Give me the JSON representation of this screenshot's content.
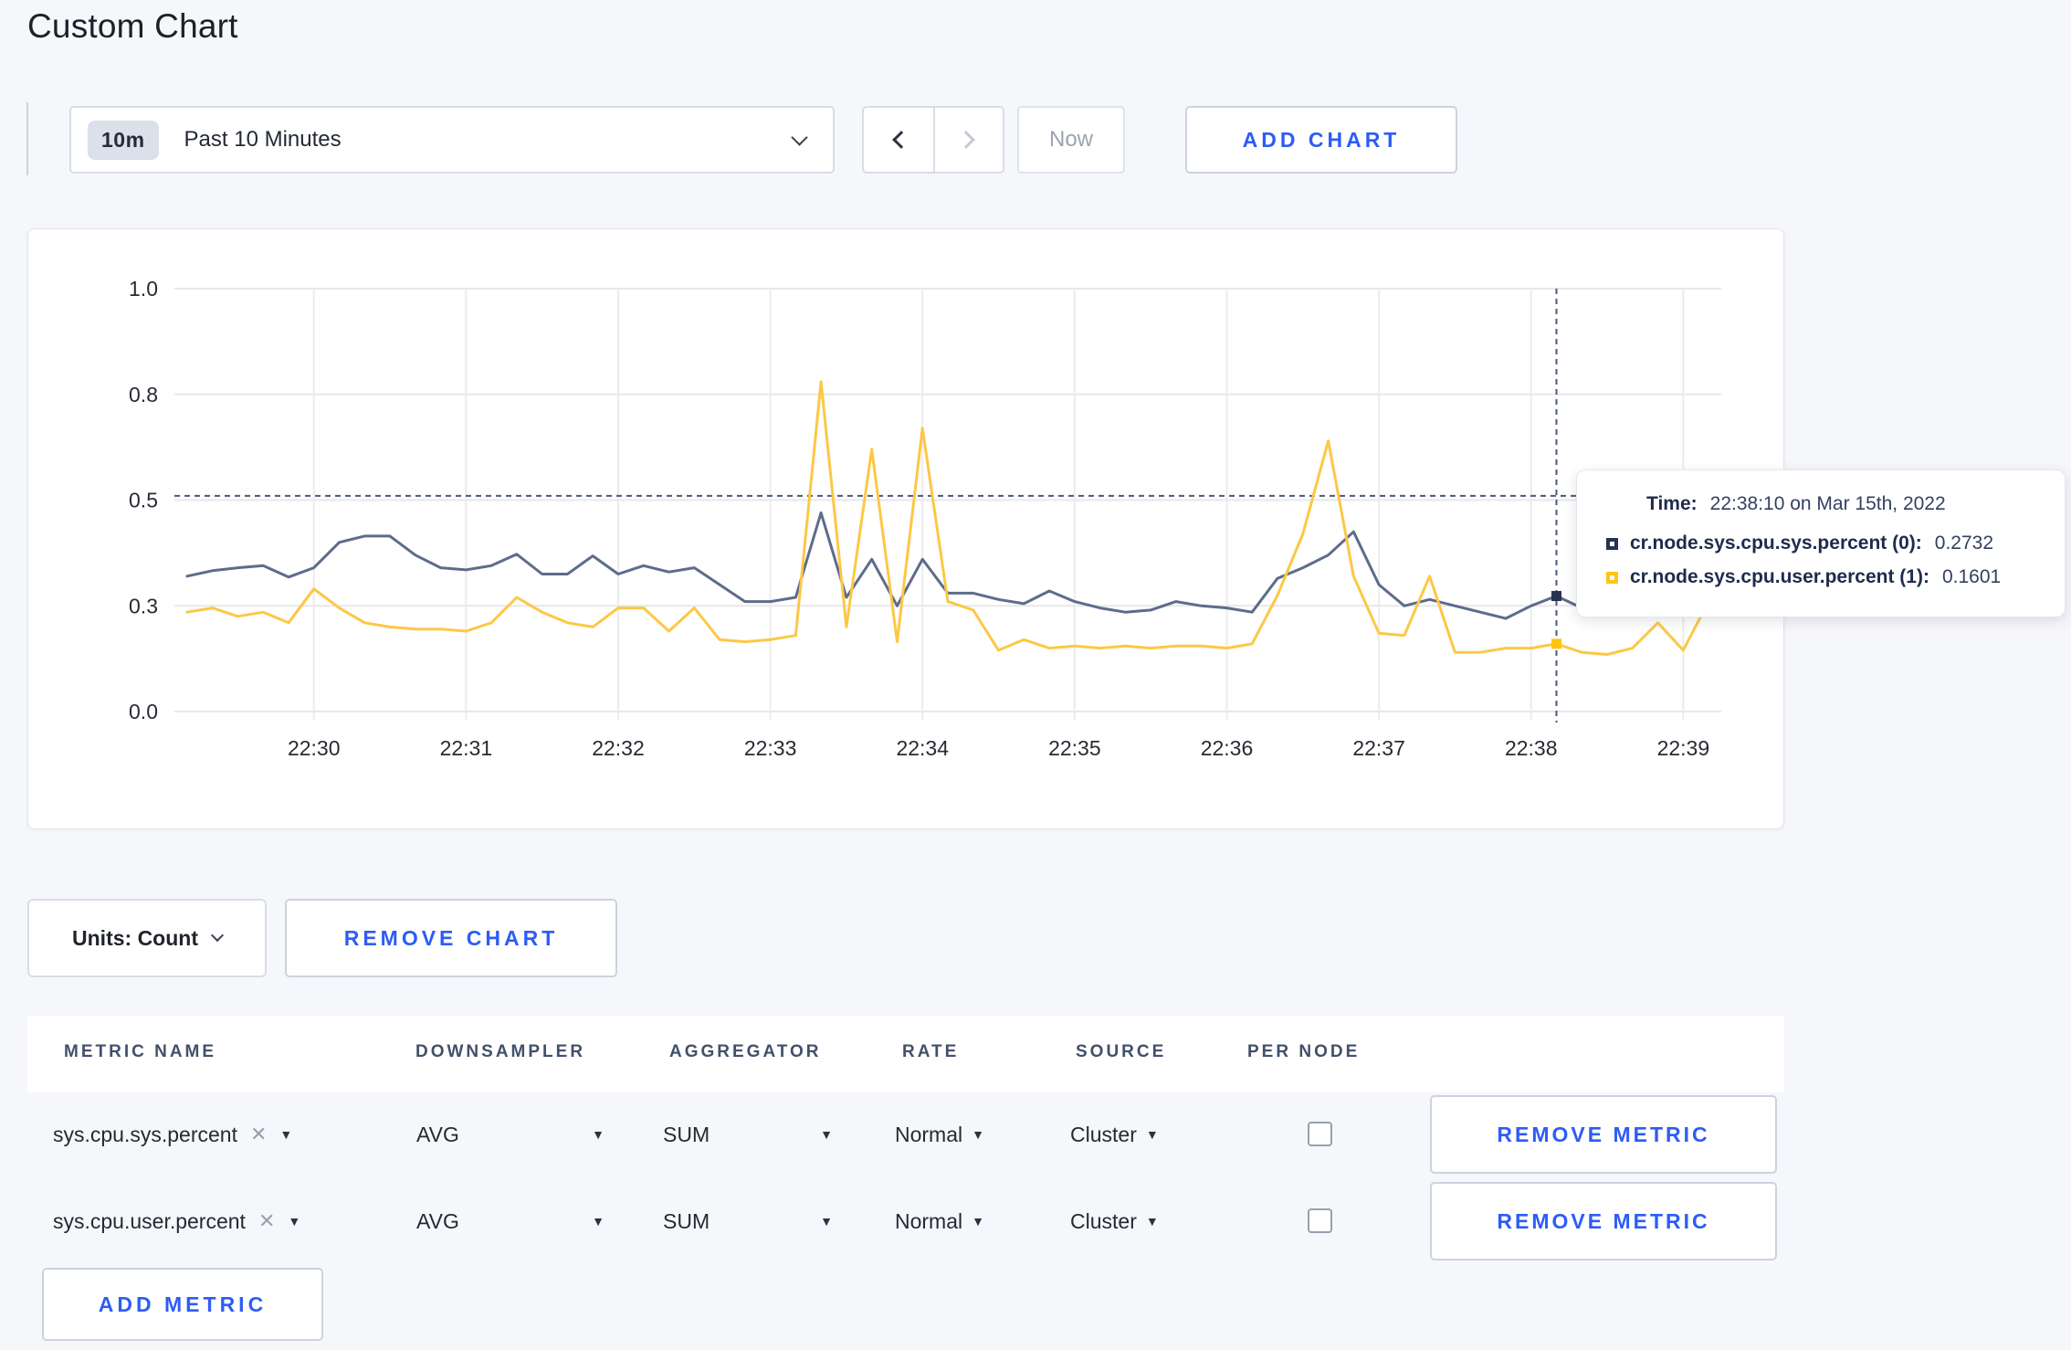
{
  "page": {
    "title": "Custom Chart",
    "accent_blue": "#2d5cf6",
    "background": "#f6f7fa"
  },
  "toolbar": {
    "time_badge": "10m",
    "time_label": "Past 10 Minutes",
    "now_label": "Now",
    "add_chart_label": "ADD CHART"
  },
  "chart_data": {
    "type": "line",
    "title": "",
    "xlabel": "",
    "ylabel": "",
    "ylim": [
      0,
      1
    ],
    "grid": true,
    "legend_position": "tooltip",
    "x_base_time": "22:29:10",
    "x_domain_seconds": [
      -5,
      605
    ],
    "y_ticks": [
      {
        "v": 0.0,
        "label": "0.0"
      },
      {
        "v": 0.25,
        "label": "0.3"
      },
      {
        "v": 0.5,
        "label": "0.5"
      },
      {
        "v": 0.75,
        "label": "0.8"
      },
      {
        "v": 1.0,
        "label": "1.0"
      }
    ],
    "x_ticks": [
      {
        "t": 50,
        "label": "22:30"
      },
      {
        "t": 110,
        "label": "22:31"
      },
      {
        "t": 170,
        "label": "22:32"
      },
      {
        "t": 230,
        "label": "22:33"
      },
      {
        "t": 290,
        "label": "22:34"
      },
      {
        "t": 350,
        "label": "22:35"
      },
      {
        "t": 410,
        "label": "22:36"
      },
      {
        "t": 470,
        "label": "22:37"
      },
      {
        "t": 530,
        "label": "22:38"
      },
      {
        "t": 590,
        "label": "22:39"
      }
    ],
    "x_seconds": [
      0,
      10,
      20,
      30,
      40,
      50,
      60,
      70,
      80,
      90,
      100,
      110,
      120,
      130,
      140,
      150,
      160,
      170,
      180,
      190,
      200,
      210,
      220,
      230,
      240,
      250,
      260,
      270,
      280,
      290,
      300,
      310,
      320,
      330,
      340,
      350,
      360,
      370,
      380,
      390,
      400,
      410,
      420,
      430,
      440,
      450,
      460,
      470,
      480,
      490,
      500,
      510,
      520,
      530,
      540,
      550,
      560,
      570,
      580,
      590,
      600
    ],
    "series": [
      {
        "name": "cr.node.sys.cpu.sys.percent",
        "line_color": "#5d6c8b",
        "legend_color": "#27334f",
        "hover_value": 0.2732,
        "values": [
          0.32,
          0.333,
          0.34,
          0.345,
          0.318,
          0.34,
          0.4,
          0.415,
          0.415,
          0.37,
          0.34,
          0.335,
          0.345,
          0.372,
          0.325,
          0.325,
          0.368,
          0.325,
          0.345,
          0.33,
          0.34,
          0.3,
          0.26,
          0.26,
          0.27,
          0.47,
          0.27,
          0.36,
          0.25,
          0.36,
          0.28,
          0.28,
          0.265,
          0.255,
          0.285,
          0.26,
          0.245,
          0.235,
          0.24,
          0.26,
          0.25,
          0.245,
          0.235,
          0.315,
          0.34,
          0.37,
          0.425,
          0.3,
          0.25,
          0.265,
          0.25,
          0.235,
          0.22,
          0.25,
          0.2732,
          0.245,
          0.285,
          0.3,
          0.285,
          0.295,
          0.3
        ]
      },
      {
        "name": "cr.node.sys.cpu.user.percent",
        "line_color": "#fcc845",
        "legend_color": "#ffc414",
        "hover_value": 0.1601,
        "values": [
          0.235,
          0.245,
          0.225,
          0.235,
          0.21,
          0.29,
          0.245,
          0.21,
          0.2,
          0.195,
          0.195,
          0.19,
          0.21,
          0.27,
          0.235,
          0.21,
          0.2,
          0.245,
          0.245,
          0.19,
          0.245,
          0.17,
          0.165,
          0.17,
          0.18,
          0.78,
          0.2,
          0.62,
          0.165,
          0.67,
          0.26,
          0.24,
          0.145,
          0.17,
          0.15,
          0.155,
          0.15,
          0.155,
          0.15,
          0.155,
          0.155,
          0.15,
          0.16,
          0.275,
          0.42,
          0.64,
          0.32,
          0.185,
          0.18,
          0.32,
          0.14,
          0.14,
          0.15,
          0.15,
          0.1601,
          0.14,
          0.135,
          0.15,
          0.21,
          0.145,
          0.26
        ]
      }
    ],
    "crosshair": {
      "t": 540,
      "v": 0.51,
      "color": "#49597a"
    },
    "colors": {
      "gridline": "#e8e8e8",
      "v_gridline": "#ececee",
      "tick_text": "#262b33"
    }
  },
  "tooltip": {
    "time_label": "Time:",
    "time_value": "22:38:10 on Mar 15th, 2022",
    "rows": [
      {
        "label": "cr.node.sys.cpu.sys.percent (0):",
        "value": "0.2732"
      },
      {
        "label": "cr.node.sys.cpu.user.percent (1):",
        "value": "0.1601"
      }
    ]
  },
  "chart_footer": {
    "units_label": "Units: Count",
    "remove_chart_label": "REMOVE CHART"
  },
  "metrics": {
    "headers": [
      "METRIC NAME",
      "DOWNSAMPLER",
      "AGGREGATOR",
      "RATE",
      "SOURCE",
      "PER NODE"
    ],
    "rows": [
      {
        "metric": "sys.cpu.sys.percent",
        "clear": "✕",
        "downsampler": "AVG",
        "aggregator": "SUM",
        "rate": "Normal",
        "source": "Cluster",
        "per_node_checked": false,
        "remove_label": "REMOVE METRIC"
      },
      {
        "metric": "sys.cpu.user.percent",
        "clear": "✕",
        "downsampler": "AVG",
        "aggregator": "SUM",
        "rate": "Normal",
        "source": "Cluster",
        "per_node_checked": false,
        "remove_label": "REMOVE METRIC"
      }
    ],
    "add_metric_label": "ADD METRIC"
  }
}
